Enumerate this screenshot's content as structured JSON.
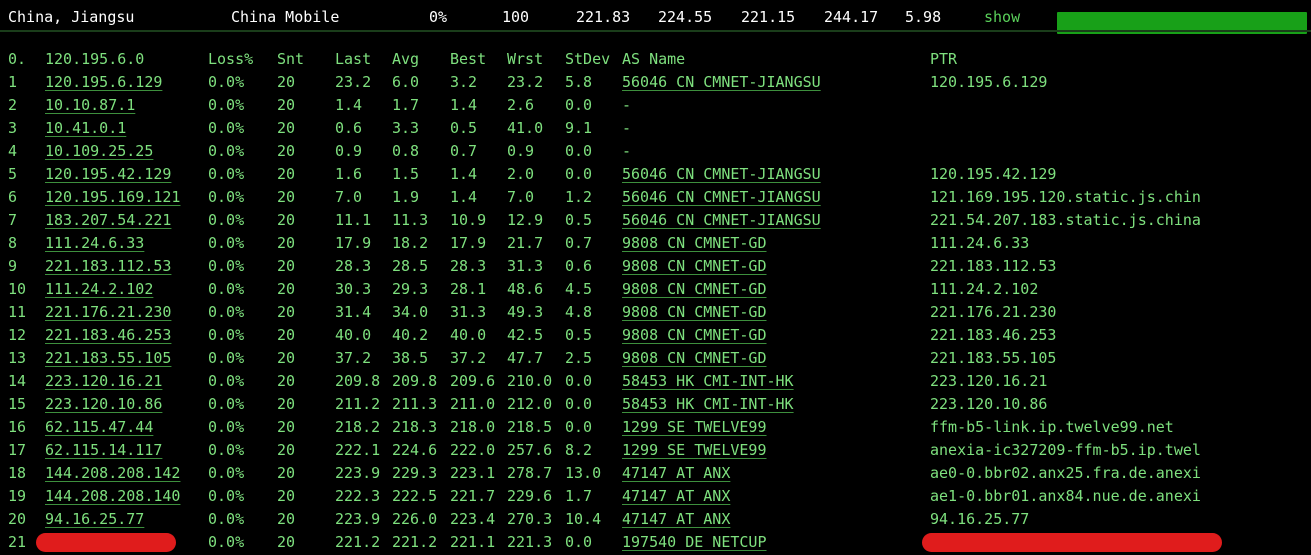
{
  "summary": {
    "location": "China, Jiangsu",
    "isp": "China Mobile",
    "loss": "0%",
    "sent": "100",
    "last": "221.83",
    "avg": "224.55",
    "best": "221.15",
    "wrst": "244.17",
    "stdev": "5.98",
    "show_label": "show"
  },
  "header": {
    "idx": "0.",
    "host": "120.195.6.0",
    "loss": "Loss%",
    "snt": "Snt",
    "last": "Last",
    "avg": "Avg",
    "best": "Best",
    "wrst": "Wrst",
    "stdev": "StDev",
    "as": "AS Name",
    "ptr": "PTR"
  },
  "hops": [
    {
      "idx": "1",
      "host": "120.195.6.129",
      "loss": "0.0%",
      "snt": "20",
      "last": "23.2",
      "avg": "6.0",
      "best": "3.2",
      "wrst": "23.2",
      "stdev": "5.8",
      "as": "56046 CN CMNET-JIANGSU",
      "ptr": "120.195.6.129"
    },
    {
      "idx": "2",
      "host": "10.10.87.1",
      "loss": "0.0%",
      "snt": "20",
      "last": "1.4",
      "avg": "1.7",
      "best": "1.4",
      "wrst": "2.6",
      "stdev": "0.0",
      "as": "-",
      "ptr": ""
    },
    {
      "idx": "3",
      "host": "10.41.0.1",
      "loss": "0.0%",
      "snt": "20",
      "last": "0.6",
      "avg": "3.3",
      "best": "0.5",
      "wrst": "41.0",
      "stdev": "9.1",
      "as": "-",
      "ptr": ""
    },
    {
      "idx": "4",
      "host": "10.109.25.25",
      "loss": "0.0%",
      "snt": "20",
      "last": "0.9",
      "avg": "0.8",
      "best": "0.7",
      "wrst": "0.9",
      "stdev": "0.0",
      "as": "-",
      "ptr": ""
    },
    {
      "idx": "5",
      "host": "120.195.42.129",
      "loss": "0.0%",
      "snt": "20",
      "last": "1.6",
      "avg": "1.5",
      "best": "1.4",
      "wrst": "2.0",
      "stdev": "0.0",
      "as": "56046 CN CMNET-JIANGSU",
      "ptr": "120.195.42.129"
    },
    {
      "idx": "6",
      "host": "120.195.169.121",
      "loss": "0.0%",
      "snt": "20",
      "last": "7.0",
      "avg": "1.9",
      "best": "1.4",
      "wrst": "7.0",
      "stdev": "1.2",
      "as": "56046 CN CMNET-JIANGSU",
      "ptr": "121.169.195.120.static.js.chin"
    },
    {
      "idx": "7",
      "host": "183.207.54.221",
      "loss": "0.0%",
      "snt": "20",
      "last": "11.1",
      "avg": "11.3",
      "best": "10.9",
      "wrst": "12.9",
      "stdev": "0.5",
      "as": "56046 CN CMNET-JIANGSU",
      "ptr": "221.54.207.183.static.js.china"
    },
    {
      "idx": "8",
      "host": "111.24.6.33",
      "loss": "0.0%",
      "snt": "20",
      "last": "17.9",
      "avg": "18.2",
      "best": "17.9",
      "wrst": "21.7",
      "stdev": "0.7",
      "as": "9808  CN CMNET-GD",
      "ptr": "111.24.6.33"
    },
    {
      "idx": "9",
      "host": "221.183.112.53",
      "loss": "0.0%",
      "snt": "20",
      "last": "28.3",
      "avg": "28.5",
      "best": "28.3",
      "wrst": "31.3",
      "stdev": "0.6",
      "as": "9808  CN CMNET-GD",
      "ptr": "221.183.112.53"
    },
    {
      "idx": "10",
      "host": "111.24.2.102",
      "loss": "0.0%",
      "snt": "20",
      "last": "30.3",
      "avg": "29.3",
      "best": "28.1",
      "wrst": "48.6",
      "stdev": "4.5",
      "as": "9808  CN CMNET-GD",
      "ptr": "111.24.2.102"
    },
    {
      "idx": "11",
      "host": "221.176.21.230",
      "loss": "0.0%",
      "snt": "20",
      "last": "31.4",
      "avg": "34.0",
      "best": "31.3",
      "wrst": "49.3",
      "stdev": "4.8",
      "as": "9808  CN CMNET-GD",
      "ptr": "221.176.21.230"
    },
    {
      "idx": "12",
      "host": "221.183.46.253",
      "loss": "0.0%",
      "snt": "20",
      "last": "40.0",
      "avg": "40.2",
      "best": "40.0",
      "wrst": "42.5",
      "stdev": "0.5",
      "as": "9808  CN CMNET-GD",
      "ptr": "221.183.46.253"
    },
    {
      "idx": "13",
      "host": "221.183.55.105",
      "loss": "0.0%",
      "snt": "20",
      "last": "37.2",
      "avg": "38.5",
      "best": "37.2",
      "wrst": "47.7",
      "stdev": "2.5",
      "as": "9808  CN CMNET-GD",
      "ptr": "221.183.55.105"
    },
    {
      "idx": "14",
      "host": "223.120.16.21",
      "loss": "0.0%",
      "snt": "20",
      "last": "209.8",
      "avg": "209.8",
      "best": "209.6",
      "wrst": "210.0",
      "stdev": "0.0",
      "as": "58453 HK CMI-INT-HK",
      "ptr": "223.120.16.21"
    },
    {
      "idx": "15",
      "host": "223.120.10.86",
      "loss": "0.0%",
      "snt": "20",
      "last": "211.2",
      "avg": "211.3",
      "best": "211.0",
      "wrst": "212.0",
      "stdev": "0.0",
      "as": "58453 HK CMI-INT-HK",
      "ptr": "223.120.10.86"
    },
    {
      "idx": "16",
      "host": "62.115.47.44",
      "loss": "0.0%",
      "snt": "20",
      "last": "218.2",
      "avg": "218.3",
      "best": "218.0",
      "wrst": "218.5",
      "stdev": "0.0",
      "as": "1299  SE TWELVE99",
      "ptr": "ffm-b5-link.ip.twelve99.net"
    },
    {
      "idx": "17",
      "host": "62.115.14.117",
      "loss": "0.0%",
      "snt": "20",
      "last": "222.1",
      "avg": "224.6",
      "best": "222.0",
      "wrst": "257.6",
      "stdev": "8.2",
      "as": "1299  SE TWELVE99",
      "ptr": "anexia-ic327209-ffm-b5.ip.twel"
    },
    {
      "idx": "18",
      "host": "144.208.208.142",
      "loss": "0.0%",
      "snt": "20",
      "last": "223.9",
      "avg": "229.3",
      "best": "223.1",
      "wrst": "278.7",
      "stdev": "13.0",
      "as": "47147 AT ANX",
      "ptr": "ae0-0.bbr02.anx25.fra.de.anexi"
    },
    {
      "idx": "19",
      "host": "144.208.208.140",
      "loss": "0.0%",
      "snt": "20",
      "last": "222.3",
      "avg": "222.5",
      "best": "221.7",
      "wrst": "229.6",
      "stdev": "1.7",
      "as": "47147 AT ANX",
      "ptr": "ae1-0.bbr01.anx84.nue.de.anexi"
    },
    {
      "idx": "20",
      "host": "94.16.25.77",
      "loss": "0.0%",
      "snt": "20",
      "last": "223.9",
      "avg": "226.0",
      "best": "223.4",
      "wrst": "270.3",
      "stdev": "10.4",
      "as": "47147 AT ANX",
      "ptr": "94.16.25.77"
    },
    {
      "idx": "21",
      "host": "",
      "loss": "0.0%",
      "snt": "20",
      "last": "221.2",
      "avg": "221.2",
      "best": "221.1",
      "wrst": "221.3",
      "stdev": "0.0",
      "as": "197540 DE NETCUP",
      "ptr": ""
    }
  ],
  "colors": {
    "background": "#000000",
    "text": "#7ee07e",
    "bar": "#18a018",
    "redaction": "#e01c1c"
  }
}
